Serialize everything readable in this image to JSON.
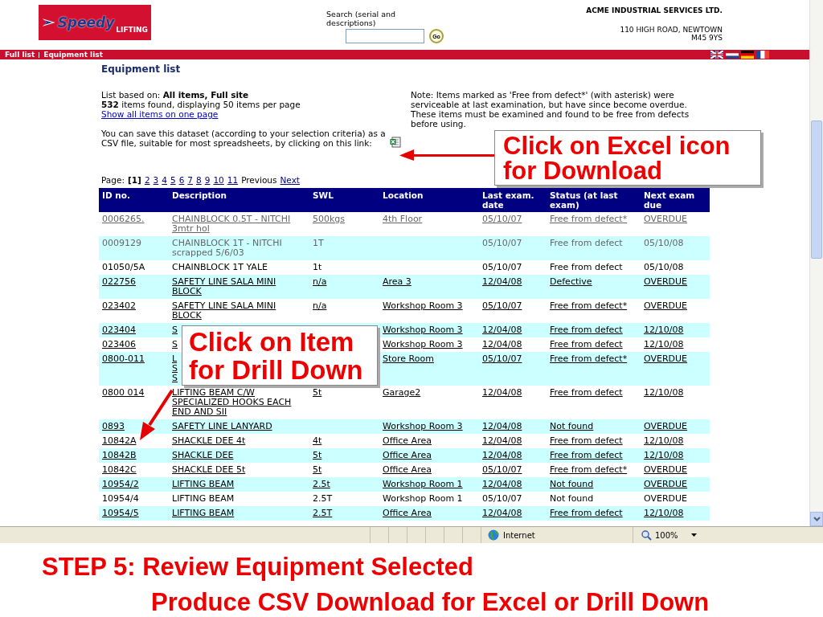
{
  "logo": {
    "name": "Speedy",
    "tagline": "LIFTING"
  },
  "search": {
    "label": "Search (serial and descriptions)",
    "button": "Go"
  },
  "company": {
    "name": "ACME INDUSTRIAL SERVICES LTD.",
    "address": [
      "110 HIGH ROAD, NEWTOWN",
      "M45 9YS"
    ]
  },
  "breadcrumbs": [
    "Full list",
    "Equipment list"
  ],
  "page_title": "Equipment list",
  "summary": {
    "basis": "List based on: **All items, Full site**",
    "count": "**532** items found, displaying 50 items per page",
    "show_all_link": "Show all items on one page"
  },
  "note": "Note: Items marked as 'Free from defect*' (with asterisk) were serviceable at last examination, but have since become overdue. These items must be examined and found to be free from defects before using.",
  "csv_text": "You can save this dataset (according to your selection criteria) as a CSV file, suitable for most spreadsheets, by clicking on this link:",
  "pagination": {
    "label": "Page:",
    "pages": [
      {
        "label": "[1]",
        "selected": true
      },
      {
        "label": "2",
        "selected": false
      },
      {
        "label": "3",
        "selected": false
      },
      {
        "label": "4",
        "selected": false
      },
      {
        "label": "5",
        "selected": false
      },
      {
        "label": "6",
        "selected": false
      },
      {
        "label": "7",
        "selected": false
      },
      {
        "label": "8",
        "selected": false
      },
      {
        "label": "9",
        "selected": false
      },
      {
        "label": "10",
        "selected": false
      },
      {
        "label": "11",
        "selected": false
      }
    ],
    "previous": "Previous",
    "next": "Next"
  },
  "table": {
    "columns": [
      "ID no.",
      "Description",
      "SWL",
      "Location",
      "Last exam. date",
      "Status (at last exam)",
      "Next exam due"
    ],
    "rows": [
      {
        "kind": "greyed",
        "cells": [
          "0006265.",
          "CHAINBLOCK 0.5T - NITCHI 3mtr hol",
          "500kgs",
          "4th Floor",
          "05/10/07",
          "Free from defect*",
          "OVERDUE"
        ]
      },
      {
        "kind": "retired",
        "cells": [
          "0009129",
          "CHAINBLOCK 1T - NITCHI scrapped 5/6/03",
          "1T",
          null,
          "05/10/07",
          "Free from defect",
          "05/10/08"
        ]
      },
      {
        "kind": "plain",
        "cells": [
          "01050/5A",
          "CHAINBLOCK 1T YALE",
          "1t",
          null,
          "05/10/07",
          "Free from defect",
          "05/10/08"
        ]
      },
      {
        "kind": "link",
        "cells": [
          "022756",
          "SAFETY LINE SALA MINI BLOCK",
          "n/a",
          "Area 3",
          "12/04/08",
          "Defective",
          "OVERDUE"
        ]
      },
      {
        "kind": "link",
        "cells": [
          "023402",
          "SAFETY LINE SALA MINI BLOCK",
          "n/a",
          "Workshop Room 3",
          "05/10/07",
          "Free from defect*",
          "OVERDUE"
        ]
      },
      {
        "kind": "link",
        "cells": [
          "023404",
          "S",
          null,
          "Workshop Room 3",
          "12/04/08",
          "Free from defect",
          "12/10/08"
        ]
      },
      {
        "kind": "link",
        "cells": [
          "023406",
          "S",
          null,
          "Workshop Room 3",
          "12/04/08",
          "Free from defect",
          "12/10/08"
        ]
      },
      {
        "kind": "link",
        "cells": [
          "0800-011",
          "L\nS\nS",
          null,
          "Store Room",
          "05/10/07",
          "Free from defect*",
          "OVERDUE"
        ]
      },
      {
        "kind": "link",
        "cells": [
          "0800 014",
          "LIFTING BEAM C/W SPECIALIZED HOOKS EACH END AND SII",
          "5t",
          "Garage2",
          "12/04/08",
          "Free from defect",
          "12/10/08"
        ]
      },
      {
        "kind": "link",
        "cells": [
          "0893",
          "SAFETY LINE LANYARD",
          null,
          "Workshop Room 3",
          "12/04/08",
          "Not found",
          "OVERDUE"
        ]
      },
      {
        "kind": "link",
        "cells": [
          "10842A",
          "SHACKLE DEE 4t",
          "4t",
          "Office Area",
          "12/04/08",
          "Free from defect",
          "12/10/08"
        ]
      },
      {
        "kind": "link",
        "cells": [
          "10842B",
          "SHACKLE DEE",
          "5t",
          "Office Area",
          "12/04/08",
          "Free from defect",
          "12/10/08"
        ]
      },
      {
        "kind": "link",
        "cells": [
          "10842C",
          "SHACKLE DEE 5t",
          "5t",
          "Office Area",
          "05/10/07",
          "Free from defect*",
          "OVERDUE"
        ]
      },
      {
        "kind": "link",
        "cells": [
          "10954/2",
          "LIFTING BEAM",
          "2.5t",
          "Workshop Room 1",
          "12/04/08",
          "Not found",
          "OVERDUE"
        ]
      },
      {
        "kind": "plain",
        "cells": [
          "10954/4",
          "LIFTING BEAM",
          "2.5T",
          "Workshop Room 1",
          "05/10/07",
          "Not found",
          "OVERDUE"
        ]
      },
      {
        "kind": "link",
        "cells": [
          "10954/5",
          "LIFTING BEAM",
          "2.5T",
          "Office Area",
          "12/04/08",
          "Free from defect",
          "12/10/08"
        ]
      }
    ]
  },
  "excel_callout": "Click on Excel icon for Download",
  "item_callout": "Click on Item for Drill Down",
  "status_bar": {
    "zone": "Internet",
    "zoom": "100%"
  },
  "caption": {
    "title": "STEP 5: Review Equipment Selected",
    "subtitle": "Produce CSV Download for Excel or Drill Down"
  }
}
